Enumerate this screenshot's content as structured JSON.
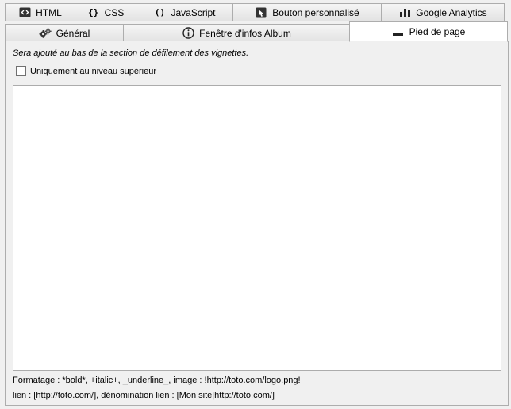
{
  "tabs_top": [
    {
      "id": "html",
      "label": "HTML",
      "icon": "html-code-icon"
    },
    {
      "id": "css",
      "label": "CSS",
      "icon": "braces-icon"
    },
    {
      "id": "javascript",
      "label": "JavaScript",
      "icon": "parentheses-icon"
    },
    {
      "id": "custom-button",
      "label": "Bouton personnalisé",
      "icon": "cursor-icon"
    },
    {
      "id": "analytics",
      "label": "Google Analytics",
      "icon": "bar-chart-icon"
    }
  ],
  "tabs_bottom": [
    {
      "id": "general",
      "label": "Général",
      "icon": "gears-icon"
    },
    {
      "id": "album-info",
      "label": "Fenêtre d'infos Album",
      "icon": "info-icon"
    },
    {
      "id": "footer",
      "label": "Pied de page",
      "icon": "footer-bar-icon",
      "active": true
    }
  ],
  "panel": {
    "hint": "Sera ajouté au bas de la section de défilement des vignettes.",
    "checkbox_label": "Uniquement au niveau supérieur",
    "checkbox_checked": false,
    "textarea_value": "",
    "formatting_help": "Formatage : *bold*, +italic+, _underline_, image : !http://toto.com/logo.png!",
    "link_help": "lien : [http://toto.com/], dénomination lien : [Mon site|http://toto.com/]"
  },
  "colors": {
    "background": "#f0f0f0",
    "border": "#adadad",
    "active_tab": "#ffffff"
  }
}
